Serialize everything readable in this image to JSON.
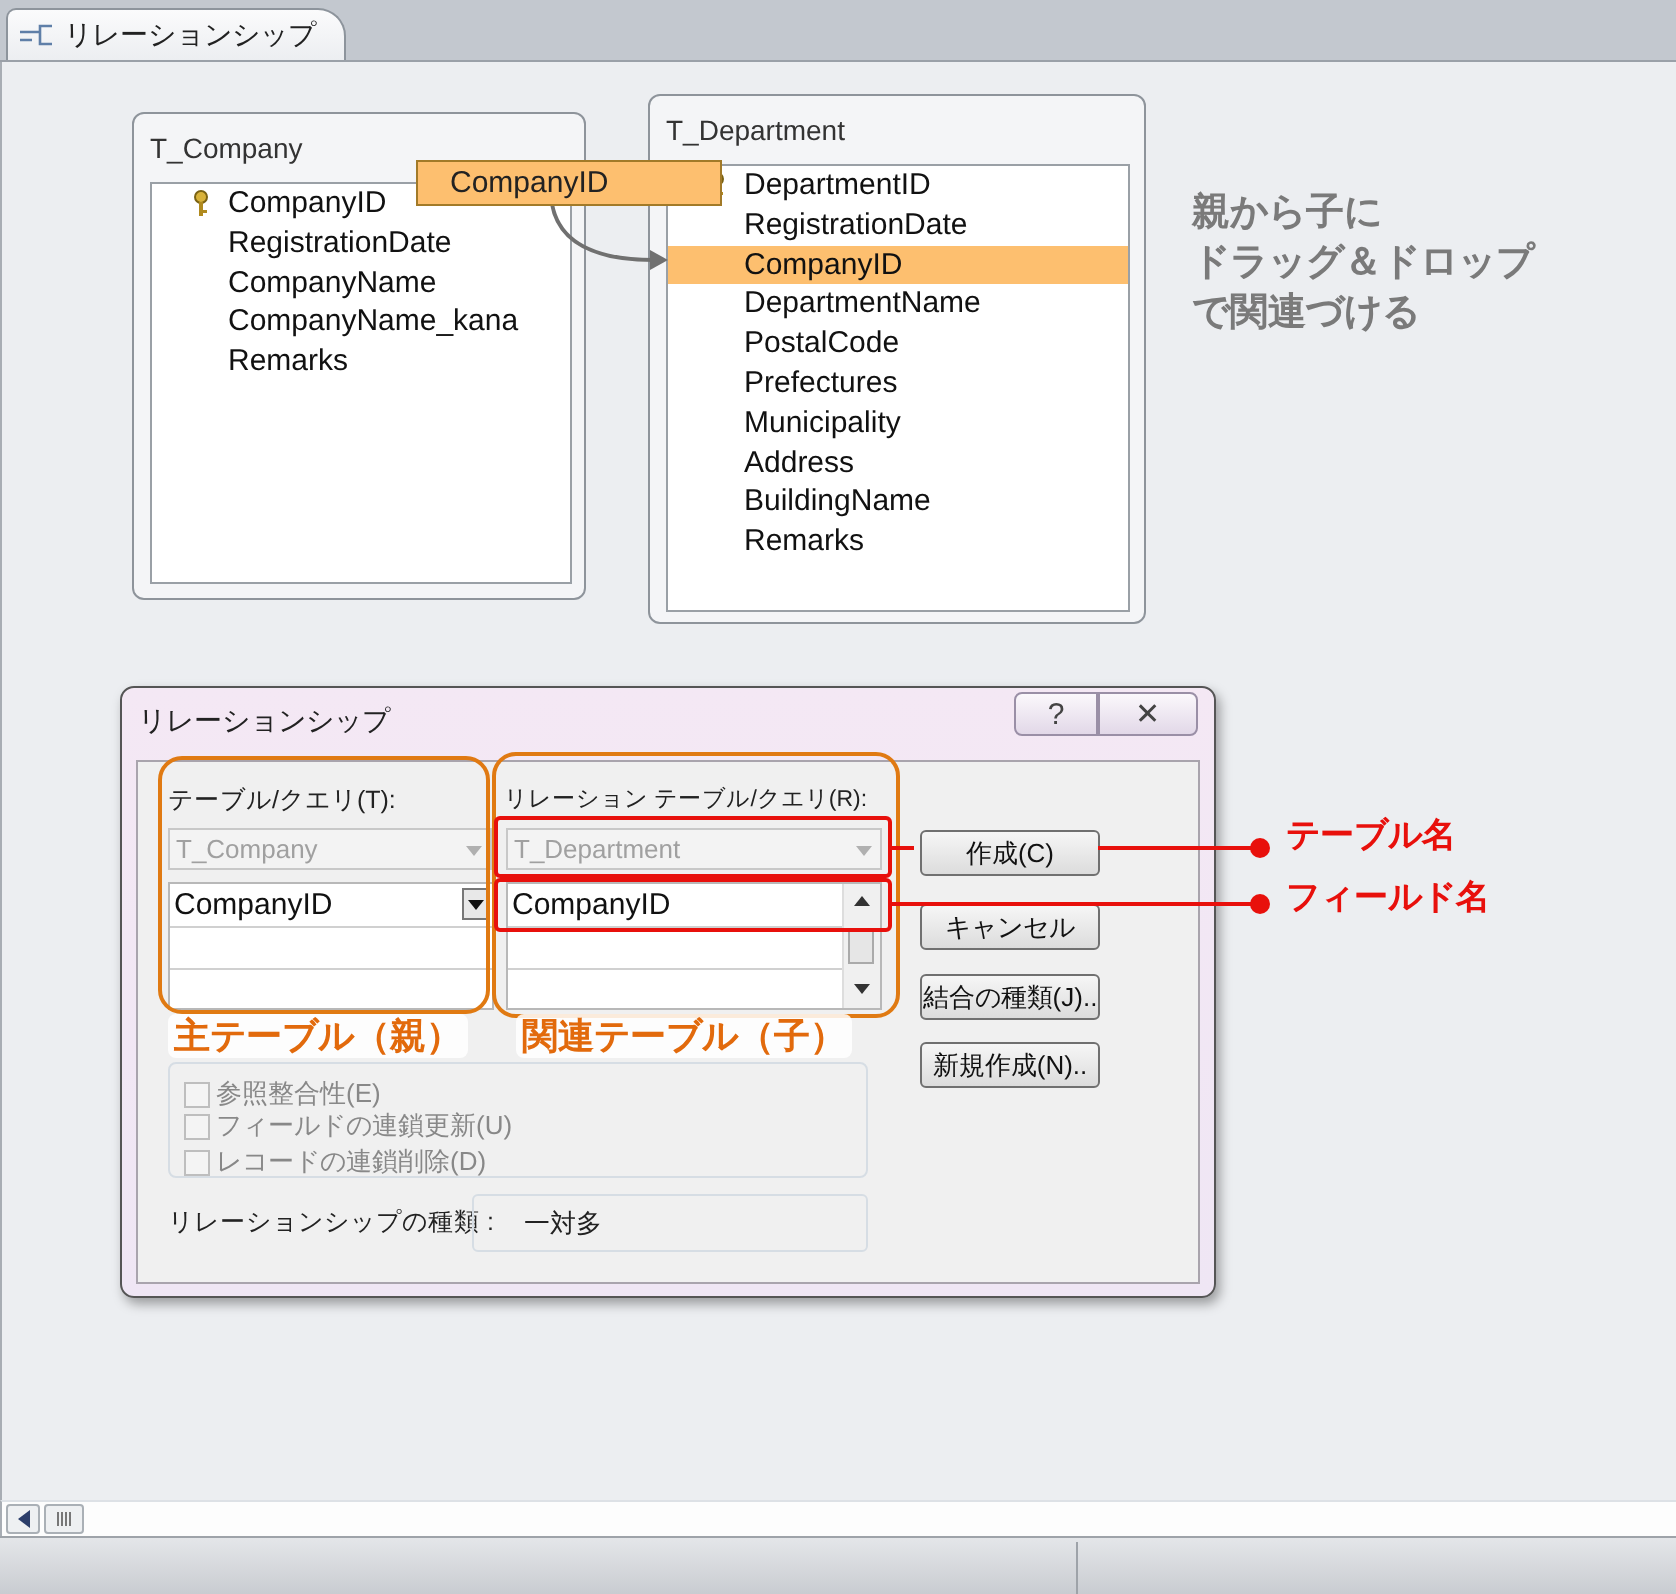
{
  "tab": {
    "label": "リレーションシップ",
    "selected": true
  },
  "tables": [
    {
      "title": "T_Company",
      "fields": [
        {
          "name": "CompanyID",
          "key": true,
          "selected": false
        },
        {
          "name": "RegistrationDate",
          "key": false,
          "selected": false
        },
        {
          "name": "CompanyName",
          "key": false,
          "selected": false
        },
        {
          "name": "CompanyName_kana",
          "key": false,
          "selected": false
        },
        {
          "name": "Remarks",
          "key": false,
          "selected": false
        }
      ]
    },
    {
      "title": "T_Department",
      "fields": [
        {
          "name": "DepartmentID",
          "key": true,
          "selected": false
        },
        {
          "name": "RegistrationDate",
          "key": false,
          "selected": false
        },
        {
          "name": "CompanyID",
          "key": false,
          "selected": true
        },
        {
          "name": "DepartmentName",
          "key": false,
          "selected": false
        },
        {
          "name": "PostalCode",
          "key": false,
          "selected": false
        },
        {
          "name": "Prefectures",
          "key": false,
          "selected": false
        },
        {
          "name": "Municipality",
          "key": false,
          "selected": false
        },
        {
          "name": "Address",
          "key": false,
          "selected": false
        },
        {
          "name": "BuildingName",
          "key": false,
          "selected": false
        },
        {
          "name": "Remarks",
          "key": false,
          "selected": false
        }
      ]
    }
  ],
  "drag_label": "CompanyID",
  "note": [
    "親から子に",
    "ドラッグ＆ドロップ",
    "で関連づける"
  ],
  "dialog": {
    "title": "リレーションシップ",
    "help_button": "?",
    "close_button": "✕",
    "table_label": "テーブル/クエリ(T):",
    "related_label": "リレーション テーブル/クエリ(R):",
    "table_combo": {
      "value": "T_Company",
      "disabled": true
    },
    "related_combo": {
      "value": "T_Department",
      "disabled": true
    },
    "table_field": "CompanyID",
    "related_field": "CompanyID",
    "buttons": [
      {
        "label": "作成(C)"
      },
      {
        "label": "キャンセル"
      },
      {
        "label": "結合の種類(J).."
      },
      {
        "label": "新規作成(N).."
      }
    ],
    "options": [
      {
        "label": "参照整合性(E)",
        "checked": false,
        "disabled": true
      },
      {
        "label": "フィールドの連鎖更新(U)",
        "checked": false,
        "disabled": true
      },
      {
        "label": "レコードの連鎖削除(D)",
        "checked": false,
        "disabled": true
      }
    ],
    "type_label": "リレーションシップの種類 :",
    "type_value": "一対多"
  },
  "callouts": [
    {
      "label": "テーブル名"
    },
    {
      "label": "フィールド名"
    }
  ],
  "captions": [
    "主テーブル（親）",
    "関連テーブル（子）"
  ]
}
